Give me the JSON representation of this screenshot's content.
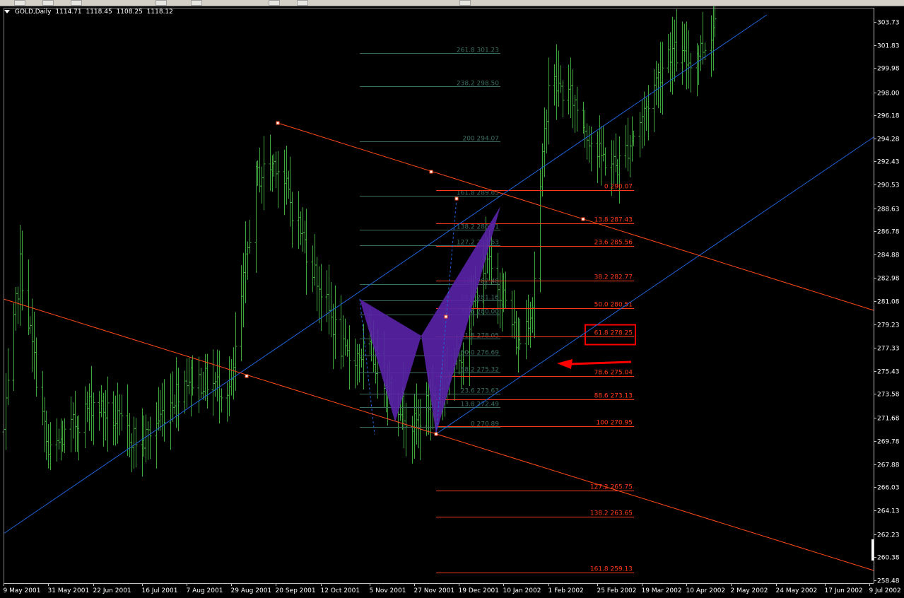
{
  "window": {
    "symbol": "GOLD,Daily",
    "ohlc": [
      "1114.71",
      "1118.45",
      "1108.25",
      "1118.12"
    ]
  },
  "colors": {
    "background": "#000000",
    "bars": "#3ea83e",
    "axis": "#c0c0c0",
    "axis_text": "#ffffff",
    "channel_blue": "#1f63d8",
    "channel_red": "#ff4a1a",
    "fib_retracement_green": "#3c6d62",
    "fib_expansion_red": "#ff3a1a",
    "pattern_fill": "#5a22a8",
    "highlight_box": "#ff0000"
  },
  "chart_data": {
    "type": "line",
    "instrument": "GOLD,Daily",
    "x_tick_labels": [
      "9 May 2001",
      "31 May 2001",
      "22 Jun 2001",
      "16 Jul 2001",
      "7 Aug 2001",
      "29 Aug 2001",
      "20 Sep 2001",
      "12 Oct 2001",
      "5 Nov 2001",
      "27 Nov 2001",
      "19 Dec 2001",
      "10 Jan 2002",
      "1 Feb 2002",
      "25 Feb 2002",
      "19 Mar 2002",
      "10 Apr 2002",
      "2 May 2002",
      "24 May 2002",
      "17 Jun 2002",
      "9 Jul 2002"
    ],
    "y_tick_labels": [
      "303.73",
      "301.83",
      "299.98",
      "298.00",
      "296.18",
      "294.28",
      "292.43",
      "290.53",
      "288.63",
      "286.78",
      "284.88",
      "282.98",
      "281.08",
      "279.23",
      "277.33",
      "275.43",
      "273.58",
      "271.68",
      "269.78",
      "267.88",
      "266.03",
      "264.13",
      "262.23",
      "260.38",
      "258.48"
    ],
    "ylim": [
      258.48,
      303.73
    ],
    "grid": false,
    "price_path": [
      {
        "x": "9 May 2001",
        "y": 270.5
      },
      {
        "x": "17 May 2001",
        "y": 284.0
      },
      {
        "x": "31 May 2001",
        "y": 268.5
      },
      {
        "x": "22 Jun 2001",
        "y": 273.0
      },
      {
        "x": "16 Jul 2001",
        "y": 269.5
      },
      {
        "x": "7 Aug 2001",
        "y": 275.0
      },
      {
        "x": "29 Aug 2001",
        "y": 274.0
      },
      {
        "x": "10 Sep 2001",
        "y": 291.0
      },
      {
        "x": "20 Sep 2001",
        "y": 292.5
      },
      {
        "x": "12 Oct 2001",
        "y": 282.0
      },
      {
        "x": "24 Oct 2001",
        "y": 276.5
      },
      {
        "x": "5 Nov 2001",
        "y": 277.0
      },
      {
        "x": "19 Nov 2001",
        "y": 273.0
      },
      {
        "x": "27 Nov 2001",
        "y": 271.0
      },
      {
        "x": "19 Dec 2001",
        "y": 276.5
      },
      {
        "x": "1 Jan 2002",
        "y": 284.5
      },
      {
        "x": "10 Jan 2002",
        "y": 281.5
      },
      {
        "x": "17 Jan 2002",
        "y": 277.5
      },
      {
        "x": "24 Jan 2002",
        "y": 281.0
      },
      {
        "x": "1 Feb 2002",
        "y": 299.0
      },
      {
        "x": "13 Feb 2002",
        "y": 297.5
      },
      {
        "x": "25 Feb 2002",
        "y": 293.0
      },
      {
        "x": "7 Mar 2002",
        "y": 292.0
      },
      {
        "x": "19 Mar 2002",
        "y": 296.0
      },
      {
        "x": "1 Apr 2002",
        "y": 301.5
      },
      {
        "x": "10 Apr 2002",
        "y": 300.5
      },
      {
        "x": "20 Apr 2002",
        "y": 302.0
      },
      {
        "x": "24 Apr 2002",
        "y": 304.0
      }
    ],
    "fib_retracement_labels": [
      {
        "level": "261.8",
        "price": "301.23"
      },
      {
        "level": "238.2",
        "price": "298.50"
      },
      {
        "level": "200",
        "price": "294.07"
      },
      {
        "level": "161.8",
        "price": "289.65"
      },
      {
        "level": "138.2",
        "price": "286.91"
      },
      {
        "level": "127.2",
        "price": "285.63"
      },
      {
        "level": "100",
        "price": "282.48"
      },
      {
        "level": "88.6",
        "price": "281.16"
      },
      {
        "level": "78.6",
        "price": "280.00"
      },
      {
        "level": "61.8",
        "price": "278.05"
      },
      {
        "level": "50.0",
        "price": "276.69"
      },
      {
        "level": "38.2",
        "price": "275.32"
      },
      {
        "level": "23.6",
        "price": "273.63"
      },
      {
        "level": "13.8",
        "price": "272.49"
      },
      {
        "level": "0",
        "price": "270.89"
      }
    ],
    "fib_expansion_labels": [
      {
        "level": "0",
        "price": "290.07",
        "label": "0 290.07"
      },
      {
        "level": "13.8",
        "price": "287.43",
        "label": "13.8 287.43"
      },
      {
        "level": "23.6",
        "price": "285.56",
        "label": "23.6 285.56"
      },
      {
        "level": "38.2",
        "price": "282.77",
        "label": "38.2 282.77"
      },
      {
        "level": "50.0",
        "price": "280.51",
        "label": "50.0 280.51"
      },
      {
        "level": "61.8",
        "price": "278.25",
        "label": "61.8 278.25",
        "highlighted": true
      },
      {
        "level": "78.6",
        "price": "275.04",
        "label": "78.6 275.04"
      },
      {
        "level": "88.6",
        "price": "273.13",
        "label": "88.6 273.13"
      },
      {
        "level": "100",
        "price": "270.95",
        "label": "100 270.95"
      },
      {
        "level": "127.2",
        "price": "265.75",
        "label": "127.2 265.75"
      },
      {
        "level": "138.2",
        "price": "263.65",
        "label": "138.2 263.65"
      },
      {
        "level": "161.8",
        "price": "259.13",
        "label": "161.8 259.13"
      }
    ],
    "annotations": {
      "red_arrow_points_to": "61.8 278.25",
      "harmonic_pattern": true
    }
  }
}
